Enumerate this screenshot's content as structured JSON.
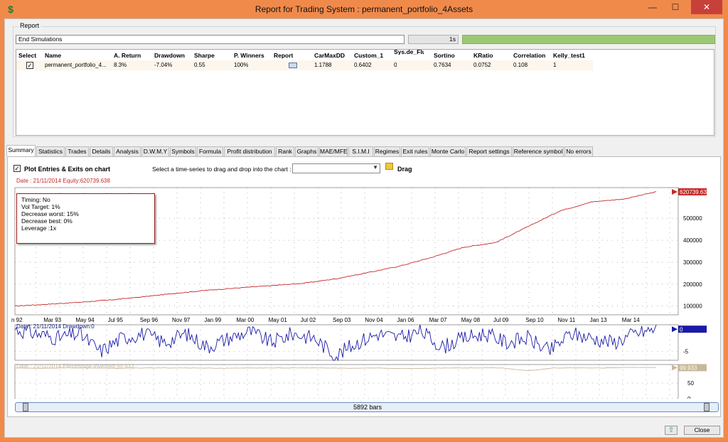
{
  "window": {
    "title": "Report for Trading System : permanent_portfolio_4Assets",
    "icon": "dollar-icon",
    "controls": {
      "minimize": "—",
      "maximize": "☐",
      "close": "✕"
    }
  },
  "report": {
    "group_label": "Report",
    "status": "End Simulations",
    "elapsed": "1s",
    "progress": 1.0,
    "columns": [
      "Select",
      "Name",
      "A. Return",
      "Drawdown",
      "Sharpe",
      "P. Winners",
      "Report",
      "CarMaxDD",
      "Custom_1",
      "Sys.de_Fluriess",
      "Sortino",
      "KRatio",
      "Correlation",
      "Kelly_test1"
    ],
    "row": {
      "selected": true,
      "name": "permanent_portfolio_4...",
      "a_return": "8.3%",
      "drawdown": "-7.04%",
      "sharpe": "0.55",
      "p_winners": "100%",
      "car_max_dd": "1.1788",
      "custom_1": "0.6402",
      "sys": "0",
      "sortino": "0.7634",
      "kratio": "0.0752",
      "correlation": "0.108",
      "kelly": "1"
    }
  },
  "tabs": [
    "Summary",
    "Statistics",
    "Trades",
    "Details",
    "Analysis",
    "D.W.M.Y",
    "Symbols",
    "Formula",
    "Profit distribution",
    "Rank",
    "Graphs",
    "MAE/MFE",
    "S.I.M.I",
    "Regimes",
    "Exit rules",
    "Monte Carlo",
    "Report settings",
    "Reference symbol",
    "No errors"
  ],
  "active_tab": "Summary",
  "summary": {
    "plot_entries_label": "Plot Entries & Exits on chart",
    "plot_entries_checked": true,
    "select_series_label": "Select a time-series to drag and drop into the chart :",
    "select_series_value": "",
    "drag_label": "Drag",
    "equity_info": "Date : 21/11/2014   Equity:620739.638",
    "tooltip_lines": [
      "Timing: No",
      "Vol Target: 1%",
      "Decrease worst: 15%",
      "Decrease best: 0%",
      "Leverage :1x"
    ],
    "drawdown_info": "Date : 21/11/2014   Drawdown:0",
    "invested_info": "Date : 21/11/2014   Percentage Invested:99.933",
    "scroll_label": "5892 bars"
  },
  "colors": {
    "equity": "#c62828",
    "drawdown": "#1a1aa8",
    "invested": "#c8b89a",
    "progress": "#9cc874"
  },
  "chart_data": [
    {
      "type": "line",
      "name": "Equity",
      "x_tick_labels": [
        "n 92",
        "Mar 93",
        "May 94",
        "Jul 95",
        "Sep 96",
        "Nov 97",
        "Jan 99",
        "Mar 00",
        "May 01",
        "Jul 02",
        "Sep 03",
        "Nov 04",
        "Jan 06",
        "Mar 07",
        "May 08",
        "Jul 09",
        "Sep 10",
        "Nov 11",
        "Jan 13",
        "Mar 14"
      ],
      "values": [
        100000,
        108000,
        117000,
        128000,
        142000,
        158000,
        172000,
        183000,
        193000,
        204000,
        224000,
        252000,
        282000,
        322000,
        368000,
        390000,
        462000,
        534000,
        575000,
        588000,
        620740
      ],
      "y_ticks": [
        100000,
        200000,
        300000,
        400000,
        500000
      ],
      "ylim": [
        60000,
        640000
      ],
      "last_value_label": "620739.638",
      "grid": true
    },
    {
      "type": "line",
      "name": "Drawdown",
      "values": [
        0,
        -1,
        -2,
        -1,
        -5,
        -2,
        -1,
        -3,
        -1,
        -4,
        -2,
        -0.5,
        -3,
        -1,
        -2,
        -6,
        -3,
        -1,
        -2,
        -0.5,
        -4,
        -2,
        -1,
        -3,
        -2,
        -5,
        -1,
        -2,
        -3,
        -1,
        0
      ],
      "y_ticks": [
        -5
      ],
      "ylim": [
        -7,
        1
      ],
      "last_value_label": "0",
      "grid": true
    },
    {
      "type": "line",
      "name": "Percentage Invested",
      "values": [
        99,
        98,
        99,
        99,
        98,
        99,
        99,
        99,
        98,
        99,
        99,
        99,
        99,
        98,
        99,
        97,
        98,
        99,
        99,
        99,
        90,
        99,
        99,
        99,
        101,
        99.933
      ],
      "y_ticks": [
        0,
        50
      ],
      "ylim": [
        -5,
        110
      ],
      "last_value_label": "99.933",
      "grid": true
    }
  ]
}
